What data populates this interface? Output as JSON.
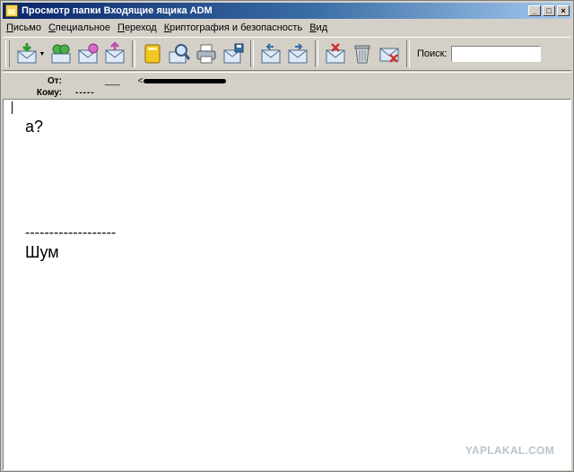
{
  "window": {
    "title": "Просмотр папки Входящие ящика ADM",
    "controls": {
      "minimize": "_",
      "maximize": "□",
      "close": "×"
    }
  },
  "menu": [
    {
      "u": "П",
      "rest": "исьмо"
    },
    {
      "u": "С",
      "rest": "пециальное"
    },
    {
      "u": "П",
      "rest": "ереход"
    },
    {
      "u": "К",
      "rest": "риптография и безопасность"
    },
    {
      "u": "В",
      "rest": "ид"
    }
  ],
  "toolbar": {
    "dropdown_arrow": "▼",
    "search_label": "Поиск:",
    "search_value": ""
  },
  "headers": {
    "from_label": "От:",
    "from_value_prefix": "<",
    "from_prefix_mark": "___",
    "to_label": "Кому:",
    "to_value": "-----"
  },
  "message": {
    "lines": [
      "а?",
      "-------------------",
      "Шум"
    ]
  },
  "watermark": "YAPLAKAL.COM"
}
